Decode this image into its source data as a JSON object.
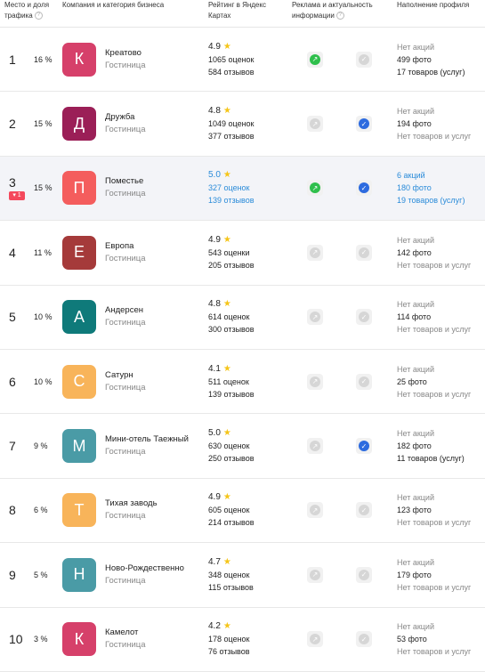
{
  "header": {
    "col_rank": "Место и доля трафика",
    "col_company": "Компания и категория бизнеса",
    "col_rating": "Рейтинг в Яндекс Картах",
    "col_ad": "Реклама и актуальность информации",
    "col_profile": "Наполнение профиля"
  },
  "rows": [
    {
      "rank": "1",
      "share": "16 %",
      "letter": "К",
      "color": "#d6406a",
      "name": "Креатово",
      "category": "Гостиница",
      "score": "4.9",
      "ratings": "1065 оценок",
      "reviews": "584 отзывов",
      "ad": "green",
      "info": "grey",
      "promo": "Нет акций",
      "photos": "499 фото",
      "goods": "17 товаров (услуг)"
    },
    {
      "rank": "2",
      "share": "15 %",
      "letter": "Д",
      "color": "#9b1f57",
      "name": "Дружба",
      "category": "Гостиница",
      "score": "4.8",
      "ratings": "1049 оценок",
      "reviews": "377 отзывов",
      "ad": "grey",
      "info": "blue",
      "promo": "Нет акций",
      "photos": "194 фото",
      "goods": "Нет товаров и услуг"
    },
    {
      "rank": "3",
      "change": "▾ 1",
      "share": "15 %",
      "letter": "П",
      "color": "#f45d5d",
      "name": "Поместье",
      "category": "Гостиница",
      "score": "5.0",
      "ratings": "327 оценок",
      "reviews": "139 отзывов",
      "ad": "green",
      "info": "blue",
      "promo": "6 акций",
      "photos": "180 фото",
      "goods": "19 товаров (услуг)",
      "highlight": true
    },
    {
      "rank": "4",
      "share": "11 %",
      "letter": "Е",
      "color": "#a53a3a",
      "name": "Европа",
      "category": "Гостиница",
      "score": "4.9",
      "ratings": "543 оценки",
      "reviews": "205 отзывов",
      "ad": "grey",
      "info": "grey",
      "promo": "Нет акций",
      "photos": "142 фото",
      "goods": "Нет товаров и услуг"
    },
    {
      "rank": "5",
      "share": "10 %",
      "letter": "А",
      "color": "#0f7a7a",
      "name": "Андерсен",
      "category": "Гостиница",
      "score": "4.8",
      "ratings": "614 оценок",
      "reviews": "300 отзывов",
      "ad": "grey",
      "info": "grey",
      "promo": "Нет акций",
      "photos": "114 фото",
      "goods": "Нет товаров и услуг"
    },
    {
      "rank": "6",
      "share": "10 %",
      "letter": "С",
      "color": "#f8b45a",
      "name": "Сатурн",
      "category": "Гостиница",
      "score": "4.1",
      "ratings": "511 оценок",
      "reviews": "139 отзывов",
      "ad": "grey",
      "info": "grey",
      "promo": "Нет акций",
      "photos": "25 фото",
      "goods": "Нет товаров и услуг"
    },
    {
      "rank": "7",
      "share": "9 %",
      "letter": "М",
      "color": "#4a9ba6",
      "name": "Мини-отель Таежный",
      "category": "Гостиница",
      "score": "5.0",
      "ratings": "630 оценок",
      "reviews": "250 отзывов",
      "ad": "grey",
      "info": "blue",
      "promo": "Нет акций",
      "photos": "182 фото",
      "goods": "11 товаров (услуг)"
    },
    {
      "rank": "8",
      "share": "6 %",
      "letter": "Т",
      "color": "#f8b45a",
      "name": "Тихая заводь",
      "category": "Гостиница",
      "score": "4.9",
      "ratings": "605 оценок",
      "reviews": "214 отзывов",
      "ad": "grey",
      "info": "grey",
      "promo": "Нет акций",
      "photos": "123 фото",
      "goods": "Нет товаров и услуг"
    },
    {
      "rank": "9",
      "share": "5 %",
      "letter": "Н",
      "color": "#4a9ba6",
      "name": "Ново-Рождественно",
      "category": "Гостиница",
      "score": "4.7",
      "ratings": "348 оценок",
      "reviews": "115 отзывов",
      "ad": "grey",
      "info": "grey",
      "promo": "Нет акций",
      "photos": "179 фото",
      "goods": "Нет товаров и услуг"
    },
    {
      "rank": "10",
      "share": "3 %",
      "letter": "К",
      "color": "#d6406a",
      "name": "Камелот",
      "category": "Гостиница",
      "score": "4.2",
      "ratings": "178 оценок",
      "reviews": "76 отзывов",
      "ad": "grey",
      "info": "grey",
      "promo": "Нет акций",
      "photos": "53 фото",
      "goods": "Нет товаров и услуг"
    }
  ]
}
